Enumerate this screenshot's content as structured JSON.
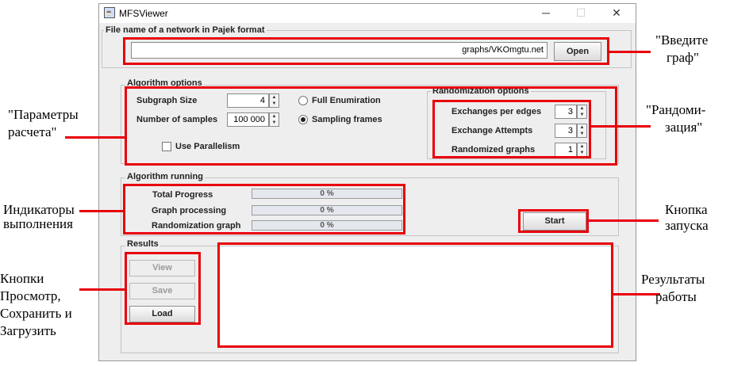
{
  "window": {
    "title": "MFSViewer",
    "controls": {
      "minimize": "─",
      "maximize": "☐",
      "close": "✕"
    }
  },
  "file_group": {
    "title": "File name of a network in Pajek format",
    "path_value": "graphs/VKOmgtu.net",
    "open_label": "Open"
  },
  "algorithm_options": {
    "title": "Algorithm options",
    "subgraph_size_label": "Subgraph Size",
    "subgraph_size_value": "4",
    "samples_label": "Number of samples",
    "samples_value": "100 000",
    "full_enum_label": "Full Enumiration",
    "sampling_label": "Sampling frames",
    "parallel_label": "Use Parallelism",
    "selected_mode": "Sampling frames",
    "use_parallelism": false
  },
  "randomization_options": {
    "title": "Randomization options",
    "exchanges_label": "Exchanges per edges",
    "exchanges_value": "3",
    "attempts_label": "Exchange Attempts",
    "attempts_value": "3",
    "graphs_label": "Randomized graphs",
    "graphs_value": "1"
  },
  "algorithm_running": {
    "title": "Algorithm running",
    "total_label": "Total Progress",
    "total_value": "0 %",
    "graph_label": "Graph processing",
    "graph_value": "0 %",
    "random_label": "Randomization graph",
    "random_value": "0 %",
    "start_label": "Start"
  },
  "results": {
    "title": "Results",
    "view_label": "View",
    "save_label": "Save",
    "load_label": "Load"
  },
  "annotations": {
    "graph_input_1": "\"Введите",
    "graph_input_2": "граф\"",
    "params_1": "\"Параметры",
    "params_2": "расчета\"",
    "random_1": "\"Рандоми-",
    "random_2": "зация\"",
    "progress_1": "Индикаторы",
    "progress_2": "выполнения",
    "start_1": "Кнопка",
    "start_2": "запуска",
    "buttons_1": "Кнопки",
    "buttons_2": "Просмотр,",
    "buttons_3": "Сохранить и",
    "buttons_4": "Загрузить",
    "results_1": "Результаты",
    "results_2": "работы"
  },
  "colors": {
    "highlight": "#e8000b",
    "window_bg": "#eeeeee"
  }
}
